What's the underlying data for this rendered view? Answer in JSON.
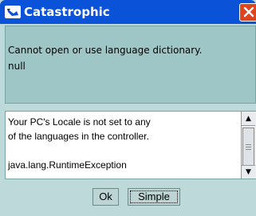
{
  "window": {
    "title": "Catastrophic",
    "title_icon": "window-icon",
    "close_icon": "close-icon"
  },
  "message": {
    "line1": "Cannot open or use language dictionary.",
    "line2": "null"
  },
  "details": {
    "text": "Your PC's Locale is not set to any\nof the languages in the controller.\n\njava.lang.RuntimeException"
  },
  "scrollbar": {
    "up_arrow": "▲",
    "down_arrow": "▼"
  },
  "buttons": {
    "ok": "Ok",
    "simple": "Simple"
  },
  "colors": {
    "titlebar": "#0a52d8",
    "close_button": "#e0441f",
    "dialog_background": "#bdd9d9",
    "message_background": "#9ec6c6"
  }
}
